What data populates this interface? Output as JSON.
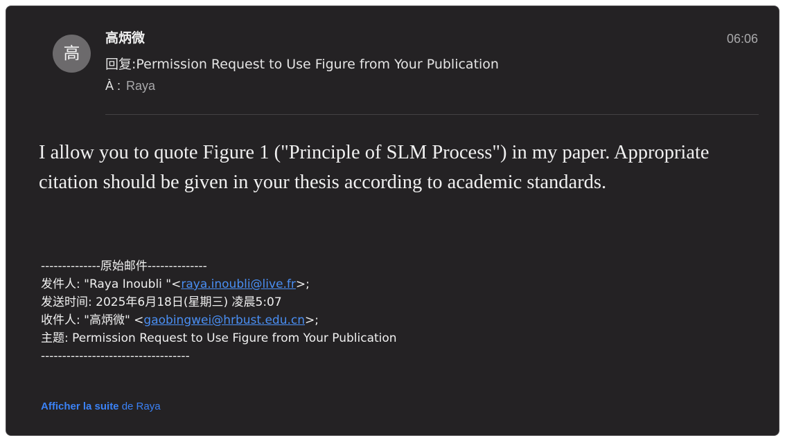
{
  "header": {
    "avatar_initial": "高",
    "sender_name": "高炳微",
    "subject": "回复:Permission Request to Use Figure from Your Publication",
    "to_label": "À :",
    "to_value": "Raya",
    "time": "06:06"
  },
  "body": {
    "text": "I allow you to quote Figure 1 (\"Principle of SLM Process\") in my paper. Appropriate citation should be given in your thesis according to academic standards."
  },
  "quoted": {
    "separator_top": "--------------原始邮件--------------",
    "from_prefix": "发件人: \"Raya Inoubli \"<",
    "from_email": "raya.inoubli@live.fr",
    "from_suffix": ">;",
    "sent_line": "发送时间: 2025年6月18日(星期三) 凌晨5:07",
    "to_prefix": "收件人: \"高炳微\" <",
    "to_email": "gaobingwei@hrbust.edu.cn",
    "to_suffix": ">;",
    "subject_line": "主题: Permission Request to Use Figure from Your Publication",
    "separator_bottom": "-----------------------------------"
  },
  "footer": {
    "show_more_link": "Afficher la suite",
    "show_more_rest": " de Raya"
  },
  "colors": {
    "background": "#242224",
    "link": "#4a8ff4",
    "avatar": "#6c6a6c"
  }
}
